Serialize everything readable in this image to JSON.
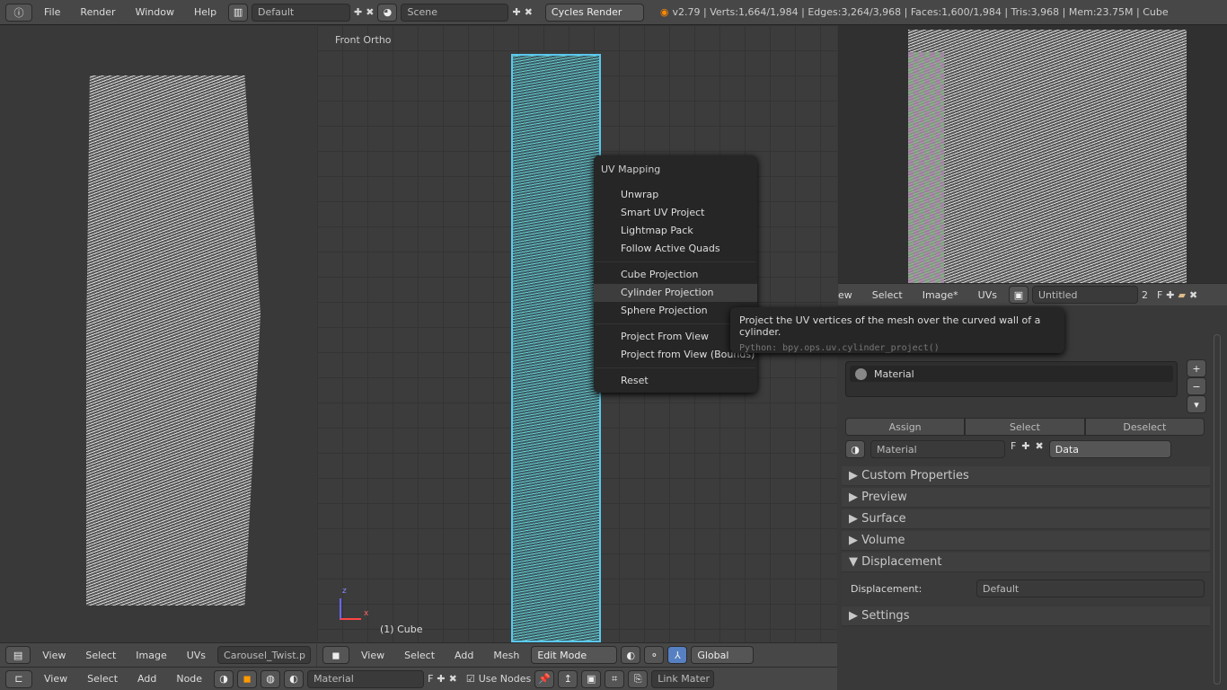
{
  "topbar": {
    "menus": [
      "File",
      "Render",
      "Window",
      "Help"
    ],
    "layout": "Default",
    "scene": "Scene",
    "engine": "Cycles Render",
    "stats": "v2.79 | Verts:1,664/1,984 | Edges:3,264/3,968 | Faces:1,600/1,984 | Tris:3,968 | Mem:23.75M | Cube"
  },
  "uv_editor": {
    "menus": [
      "View",
      "Select",
      "Image",
      "UVs"
    ],
    "image": "Carousel_Twist.p"
  },
  "viewport": {
    "label": "Front Ortho",
    "object": "(1) Cube",
    "menus": [
      "View",
      "Select",
      "Add",
      "Mesh"
    ],
    "mode": "Edit Mode",
    "orientation": "Global",
    "axis_z": "z",
    "axis_x": "x"
  },
  "image_editor": {
    "menus": [
      "ew",
      "Select",
      "Image*",
      "UVs"
    ],
    "image": "Untitled",
    "users": "2",
    "fake": "F"
  },
  "node_editor": {
    "menus": [
      "View",
      "Select",
      "Add",
      "Node"
    ],
    "material": "Material",
    "fake": "F",
    "use_nodes": "Use Nodes",
    "link": "Link Mater"
  },
  "context_menu": {
    "title": "UV Mapping",
    "groups": [
      [
        "Unwrap",
        "Smart UV Project",
        "Lightmap Pack",
        "Follow Active Quads"
      ],
      [
        "Cube Projection",
        "Cylinder Projection",
        "Sphere Projection"
      ],
      [
        "Project From View",
        "Project from View (Bounds)"
      ],
      [
        "Reset"
      ]
    ],
    "highlighted": "Cylinder Projection"
  },
  "tooltip": {
    "text": "Project the UV vertices of the mesh over the curved wall of a cylinder.",
    "python": "Python: bpy.ops.uv.cylinder_project()"
  },
  "properties": {
    "slot": "Material",
    "assign": "Assign",
    "select": "Select",
    "deselect": "Deselect",
    "material": "Material",
    "fake": "F",
    "link": "Data",
    "panels": [
      "Custom Properties",
      "Preview",
      "Surface",
      "Volume",
      "Displacement",
      "Settings"
    ],
    "displacement_label": "Displacement:",
    "displacement_value": "Default"
  }
}
